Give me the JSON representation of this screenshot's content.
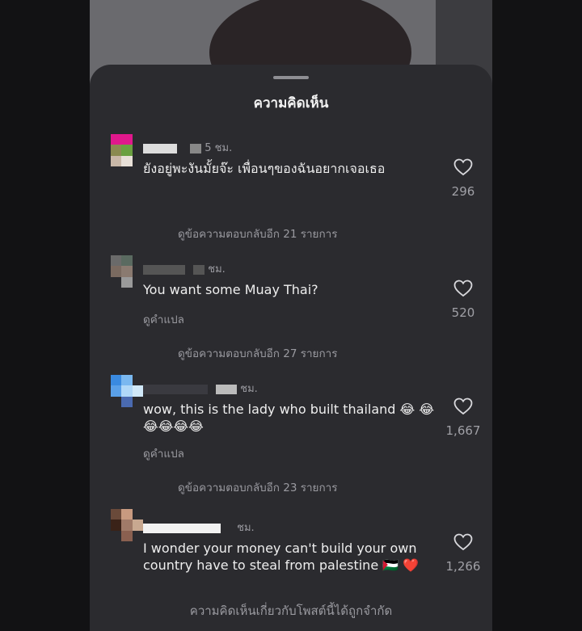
{
  "sheet": {
    "title": "ความคิดเห็น"
  },
  "comments": [
    {
      "time": "5 ชม.",
      "text": "ยังอยู่พะงันมั้ยจ๊ะ เพื่อนๆของฉันอยากเจอเธอ",
      "translate": "",
      "likes": "296",
      "replies": "ดูข้อความตอบกลับอีก 21 รายการ",
      "avatar_colors": [
        "#e0188c",
        "#e0188c",
        "#2b2b2f",
        "#8a8a50",
        "#6aa040",
        "#2b2b2f",
        "#c9b8a8",
        "#e8e0d8",
        "#2b2b2f"
      ]
    },
    {
      "time": "ชม.",
      "text": "You want some Muay Thai?",
      "translate": "ดูคำแปล",
      "likes": "520",
      "replies": "ดูข้อความตอบกลับอีก 27 รายการ",
      "avatar_colors": [
        "#6a6a6a",
        "#5a6a60",
        "#2b2b2f",
        "#7a6a60",
        "#8a7a70",
        "#2b2b2f",
        "#2b2b2f",
        "#9a9a9a",
        "#2b2b2f"
      ]
    },
    {
      "time": "ชม.",
      "text": "wow, this is the lady who built thailand 😂 😂😂😂😂😂",
      "translate": "ดูคำแปล",
      "likes": "1,667",
      "replies": "ดูข้อความตอบกลับอีก 23 รายการ",
      "avatar_colors": [
        "#3a8ae0",
        "#7ab8f0",
        "#2b2b2f",
        "#5aa0e8",
        "#b0d8f8",
        "#d0e8f8",
        "#2b2b2f",
        "#4a6ab0",
        "#2b2b2f"
      ]
    },
    {
      "time": "ชม.",
      "text": "I wonder your money can't build your own country have to steal from palestine 🇵🇸 ❤️",
      "translate": "",
      "likes": "1,266",
      "replies": "",
      "avatar_colors": [
        "#6a4a3a",
        "#c89a80",
        "#2b2b2f",
        "#3a2218",
        "#a07a68",
        "#c8a890",
        "#2b2b2f",
        "#8a6050",
        "#2b2b2f"
      ]
    }
  ],
  "footer": "ความคิดเห็นเกี่ยวกับโพสต์นี้ได้ถูกจำกัด",
  "colors": {
    "sheet_bg": "#2b2b2f",
    "muted": "#9a9aa0",
    "text": "#eeeeee"
  },
  "icons": {
    "like": "heart-outline-icon"
  }
}
